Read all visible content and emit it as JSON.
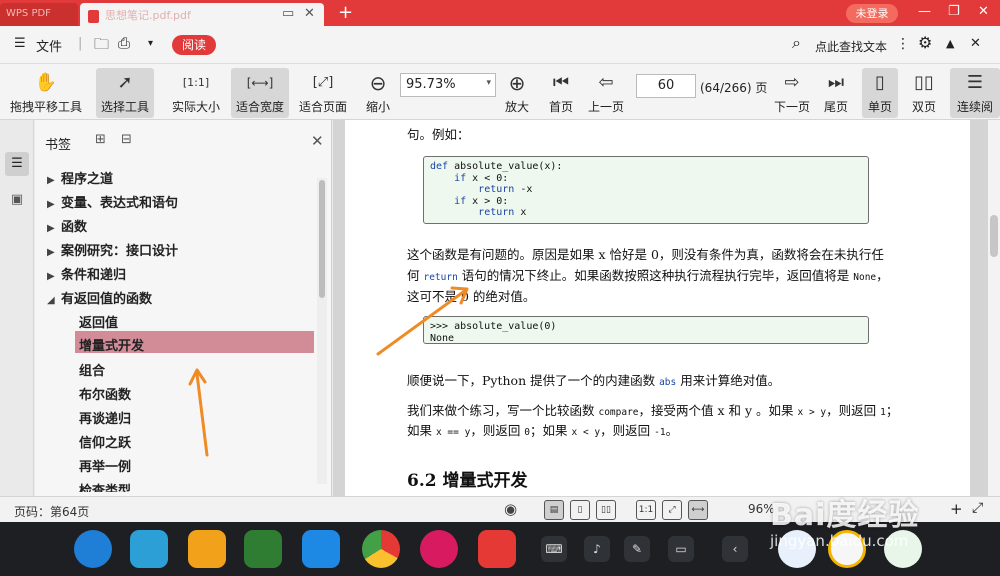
{
  "titlebar": {
    "app_tab": "WPS PDF",
    "doc_tab": "思想笔记.pdf.pdf",
    "new_tab": "+",
    "login": "未登录"
  },
  "menubar": {
    "file": "文件",
    "read": "阅读",
    "search": "点此查找文本"
  },
  "toolbar": {
    "pan": "拖拽平移工具",
    "select": "选择工具",
    "actual_size": "实际大小",
    "fit_width": "适合宽度",
    "fit_page": "适合页面",
    "zoom_out": "缩小",
    "zoom_value": "95.73%",
    "zoom_in": "放大",
    "first_page": "首页",
    "prev_page": "上一页",
    "page_number": "60",
    "page_total": "(64/266) 页",
    "next_page": "下一页",
    "last_page": "尾页",
    "single_page": "单页",
    "double_page": "双页",
    "continuous": "连续阅"
  },
  "bookmarks": {
    "title": "书签",
    "items": [
      {
        "label": "程序之道",
        "expandable": true
      },
      {
        "label": "变量、表达式和语句",
        "expandable": true
      },
      {
        "label": "函数",
        "expandable": true
      },
      {
        "label": "案例研究：接口设计",
        "expandable": true
      },
      {
        "label": "条件和递归",
        "expandable": true
      },
      {
        "label": "有返回值的函数",
        "expanded": true
      }
    ],
    "children": [
      "返回值",
      "增量式开发",
      "组合",
      "布尔函数",
      "再谈递归",
      "信仰之跃",
      "再举一例",
      "检查类型"
    ],
    "selected": "增量式开发"
  },
  "document": {
    "intro": "句。例如：",
    "code1": {
      "line1_kw": "def",
      "line1_rest": " absolute_value(x):",
      "line2_kw": "if",
      "line2_rest": " x < 0:",
      "line3_kw": "return",
      "line3_rest": " -x",
      "line4_kw": "if",
      "line4_rest": " x > 0:",
      "line5_kw": "return",
      "line5_rest": " x"
    },
    "para1_l1": "这个函数是有问题的。原因是如果 x 恰好是 0，则没有条件为真，函数将会在未执行任",
    "para1_l2a": "何 ",
    "para1_l2_kw": "return",
    "para1_l2b": " 语句的情况下终止。如果函数按照这种执行流程执行完毕，返回值将是 ",
    "para1_l2_none": "None",
    "para1_l2c": "，",
    "para1_l3": "这可不是 0 的绝对值。",
    "code2_l1": ">>> absolute_value(0)",
    "code2_l2": "None",
    "para2a": "顺便说一下，Python 提供了一个的内建函数 ",
    "para2_abs": "abs",
    "para2b": " 用来计算绝对值。",
    "para3_l1a": "我们来做个练习，写一个比较函数 ",
    "para3_compare": "compare",
    "para3_l1b": "，接受两个值 x 和 y 。如果 ",
    "para3_xgy": "x > y",
    "para3_l1c": "，则返回 ",
    "para3_1": "1",
    "para3_l1d": "；",
    "para3_l2a": "如果 ",
    "para3_xeqy": "x == y",
    "para3_l2b": "，则返回 ",
    "para3_0": "0",
    "para3_l2c": "；如果 ",
    "para3_xly": "x < y",
    "para3_l2d": "，则返回 ",
    "para3_m1": "-1",
    "para3_l2e": "。",
    "heading": "6.2    增量式开发"
  },
  "statusbar": {
    "page": "页码：第64页",
    "zoom": "96%"
  },
  "watermark": {
    "brand": "Bai度经验",
    "url": "jingyan.baidu.com"
  },
  "colors": {
    "accent_red": "#e23a3a",
    "selection": "#d28c98",
    "arrow": "#f08a24",
    "code_bg": "#eef8ee"
  }
}
